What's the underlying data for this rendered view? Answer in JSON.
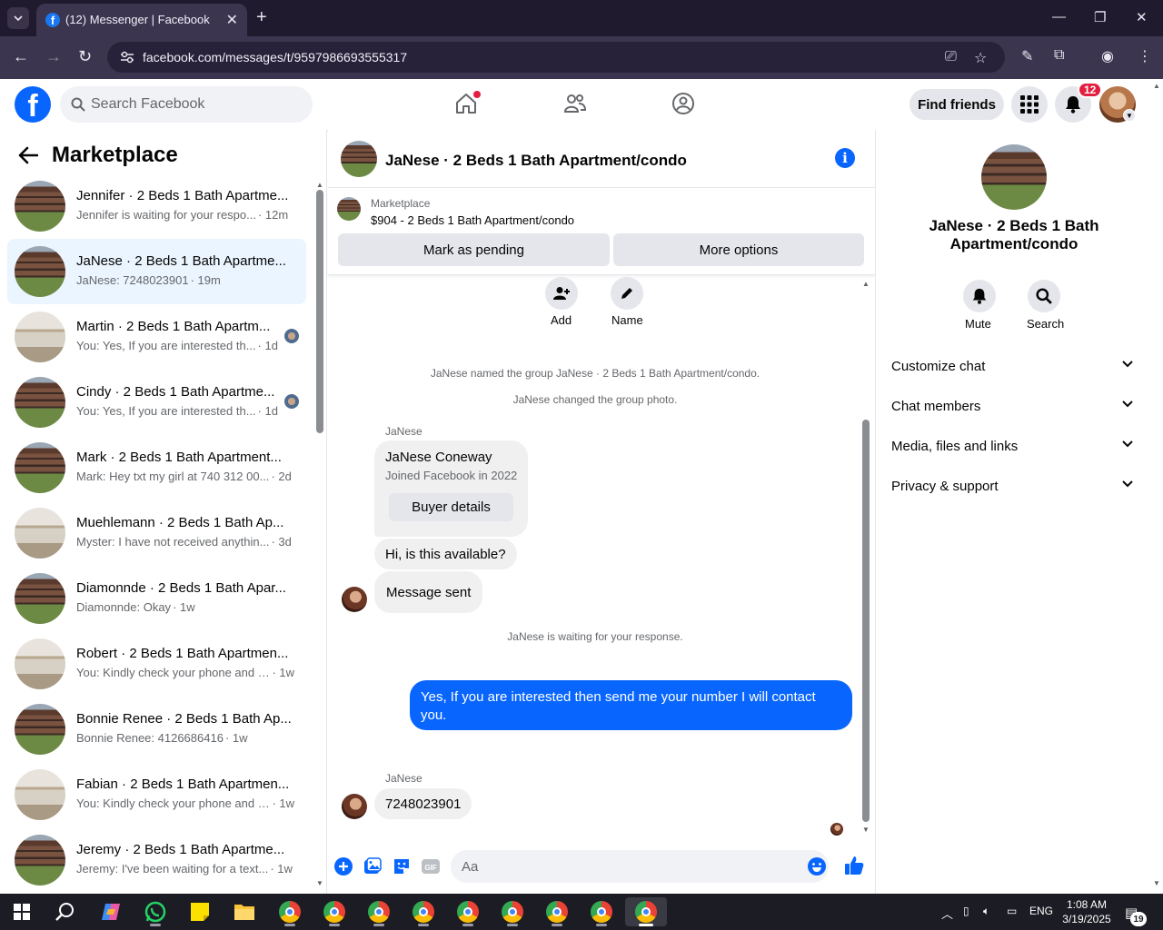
{
  "browser": {
    "tab_title": "(12) Messenger | Facebook",
    "url": "facebook.com/messages/t/9597986693555317",
    "new_tab_label": "+",
    "close_tab_label": "✕"
  },
  "fb_header": {
    "search_placeholder": "Search Facebook",
    "find_friends_label": "Find friends",
    "notification_count": "12"
  },
  "left_panel": {
    "title": "Marketplace",
    "conversations": [
      {
        "name": "Jennifer · 2 Beds 1 Bath Apartme...",
        "preview": "Jennifer is waiting for your respo...",
        "time": "· 12m",
        "thumb": "building",
        "active": false,
        "seen": false
      },
      {
        "name": "JaNese · 2 Beds 1 Bath Apartme...",
        "preview": "JaNese: 7248023901",
        "time": "· 19m",
        "thumb": "building",
        "active": true,
        "seen": false
      },
      {
        "name": "Martin · 2 Beds 1 Bath Apartm...",
        "preview": "You: Yes, If you are interested th...",
        "time": "· 1d",
        "thumb": "interior",
        "active": false,
        "seen": true
      },
      {
        "name": "Cindy · 2 Beds 1 Bath Apartme...",
        "preview": "You: Yes, If you are interested th...",
        "time": "· 1d",
        "thumb": "building",
        "active": false,
        "seen": true
      },
      {
        "name": "Mark · 2 Beds 1 Bath Apartment...",
        "preview": "Mark: Hey txt my girl at 740 312 00...",
        "time": "· 2d",
        "thumb": "building",
        "active": false,
        "seen": false
      },
      {
        "name": "Muehlemann · 2 Beds 1 Bath Ap...",
        "preview": "Myster: I have not received anythin...",
        "time": "· 3d",
        "thumb": "interior",
        "active": false,
        "seen": false
      },
      {
        "name": "Diamonnde · 2 Beds 1 Bath Apar...",
        "preview": "Diamonnde: Okay",
        "time": "· 1w",
        "thumb": "building",
        "active": false,
        "seen": false
      },
      {
        "name": "Robert · 2 Beds 1 Bath Apartmen...",
        "preview": "You: Kindly check your phone and I...",
        "time": "· 1w",
        "thumb": "interior",
        "active": false,
        "seen": false
      },
      {
        "name": "Bonnie Renee · 2 Beds 1 Bath Ap...",
        "preview": "Bonnie Renee: 4126686416",
        "time": "· 1w",
        "thumb": "building",
        "active": false,
        "seen": false
      },
      {
        "name": "Fabian · 2 Beds 1 Bath Apartmen...",
        "preview": "You: Kindly check your phone and I...",
        "time": "· 1w",
        "thumb": "interior",
        "active": false,
        "seen": false
      },
      {
        "name": "Jeremy · 2 Beds 1 Bath Apartme...",
        "preview": "Jeremy: I've been waiting for a text...",
        "time": "· 1w",
        "thumb": "building",
        "active": false,
        "seen": false
      }
    ]
  },
  "chat": {
    "title": "JaNese · 2 Beds 1 Bath Apartment/condo",
    "info_icon_label": "i",
    "marketplace_label": "Marketplace",
    "listing": "$904 - 2 Beds 1 Bath Apartment/condo",
    "mark_pending_label": "Mark as pending",
    "more_options_label": "More options",
    "add_label": "Add",
    "name_label": "Name",
    "system_named": "JaNese named the group JaNese · 2 Beds 1 Bath Apartment/condo.",
    "system_photo": "JaNese changed the group photo.",
    "sender_name": "JaNese",
    "card_name": "JaNese Coneway",
    "card_sub": "Joined Facebook in 2022",
    "buyer_details_label": "Buyer details",
    "msg_available": "Hi, is this available?",
    "msg_sent": "Message sent",
    "system_waiting": "JaNese is waiting for your response.",
    "msg_outgoing": "Yes, If you are interested then send me your number I will contact you.",
    "sender_name_2": "JaNese",
    "msg_number": "7248023901",
    "composer_placeholder": "Aa"
  },
  "right_panel": {
    "title": "JaNese · 2 Beds 1 Bath Apartment/condo",
    "mute_label": "Mute",
    "search_label": "Search",
    "sections": [
      "Customize chat",
      "Chat members",
      "Media, files and links",
      "Privacy & support"
    ]
  },
  "taskbar": {
    "language": "ENG",
    "time": "1:08 AM",
    "date": "3/19/2025",
    "notification_count": "19"
  },
  "colors": {
    "fb_blue": "#0866ff",
    "badge_red": "#e41e3f",
    "active_row": "#ebf5ff",
    "browser_bg": "#3c3550"
  }
}
